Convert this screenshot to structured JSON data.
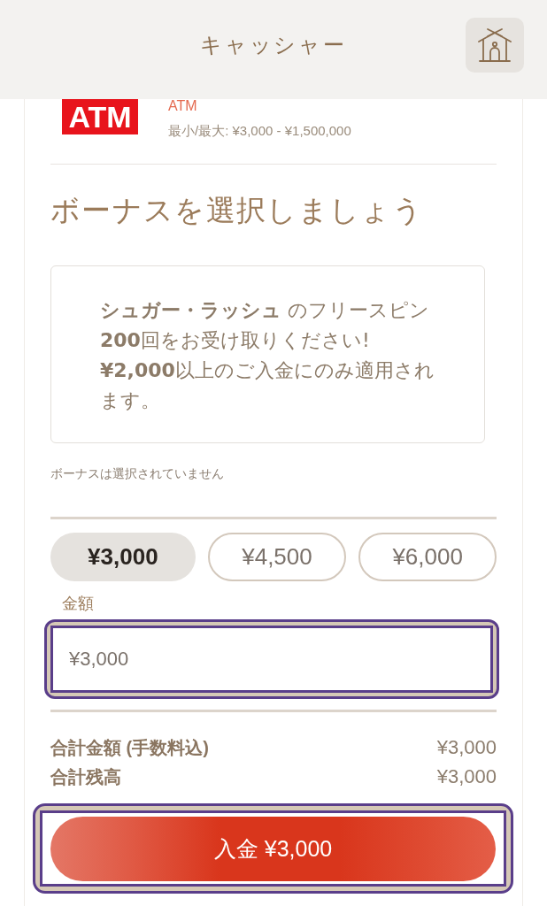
{
  "header": {
    "title": "キャッシャー"
  },
  "payment_method": {
    "logo_text": "ATM",
    "name": "ATM",
    "limits": "最小/最大: ¥3,000 - ¥1,500,000"
  },
  "bonus": {
    "heading": "ボーナスを選択しましょう",
    "offer": {
      "sentences": [
        "**シュガー・ラッシュ** のフリースピン**200**回をお受け取りください!",
        "**¥2,000**以上のご入金にのみ適用されます。"
      ],
      "selected": false
    },
    "status": "ボーナスは選択されていません"
  },
  "amount_options": [
    {
      "label": "¥3,000",
      "selected": true
    },
    {
      "label": "¥4,500",
      "selected": false
    },
    {
      "label": "¥6,000",
      "selected": false
    }
  ],
  "amount_field": {
    "label": "金額",
    "value": "¥3,000",
    "focused": true
  },
  "summary": [
    {
      "label": "合計金額 (手数料込)",
      "value": "¥3,000"
    },
    {
      "label": "合計残高",
      "value": "¥3,000"
    }
  ],
  "deposit_button": {
    "label": "入金 ¥3,000",
    "focused": true
  }
}
